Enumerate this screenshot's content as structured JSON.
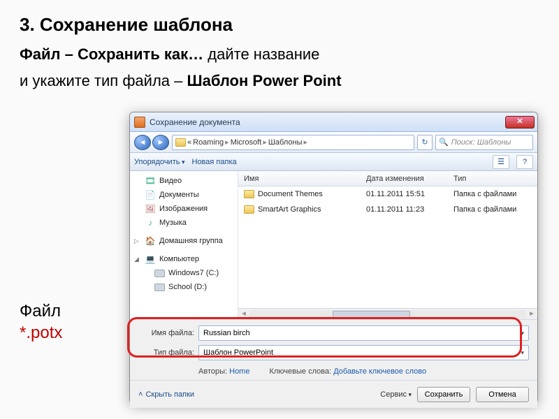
{
  "slide": {
    "heading": "3. Сохранение шаблона",
    "line1_bold": "Файл – Сохранить как…",
    "line1_rest": " дайте название",
    "line2_plain": "и укажите тип файла – ",
    "line2_bold": "Шаблон Power Point",
    "ext_label": "Файл",
    "ext_pattern": "*.potx"
  },
  "dialog": {
    "title": "Сохранение документа",
    "breadcrumb": [
      "«",
      "Roaming",
      "Microsoft",
      "Шаблоны"
    ],
    "search_placeholder": "Поиск: Шаблоны",
    "toolbar": {
      "organize": "Упорядочить",
      "new_folder": "Новая папка"
    },
    "tree": [
      {
        "label": "Видео",
        "icon": "video"
      },
      {
        "label": "Документы",
        "icon": "doc"
      },
      {
        "label": "Изображения",
        "icon": "img"
      },
      {
        "label": "Музыка",
        "icon": "music"
      },
      {
        "label": "Домашняя группа",
        "icon": "home",
        "exp": "▷"
      },
      {
        "label": "Компьютер",
        "icon": "pc",
        "exp": "◢"
      },
      {
        "label": "Windows7 (C:)",
        "icon": "disk",
        "indent": true
      },
      {
        "label": "School (D:)",
        "icon": "disk",
        "indent": true
      }
    ],
    "columns": {
      "name": "Имя",
      "date": "Дата изменения",
      "type": "Тип"
    },
    "rows": [
      {
        "name": "Document Themes",
        "date": "01.11.2011 15:51",
        "type": "Папка с файлами"
      },
      {
        "name": "SmartArt Graphics",
        "date": "01.11.2011 11:23",
        "type": "Папка с файлами"
      }
    ],
    "form": {
      "filename_label": "Имя файла:",
      "filename_value": "Russian birch",
      "filetype_label": "Тип файла:",
      "filetype_value": "Шаблон PowerPoint",
      "authors_label": "Авторы:",
      "authors_value": "Home",
      "keywords_label": "Ключевые слова:",
      "keywords_value": "Добавьте ключевое слово"
    },
    "footer": {
      "hide_folders": "Скрыть папки",
      "tools": "Сервис",
      "save": "Сохранить",
      "cancel": "Отмена"
    }
  }
}
